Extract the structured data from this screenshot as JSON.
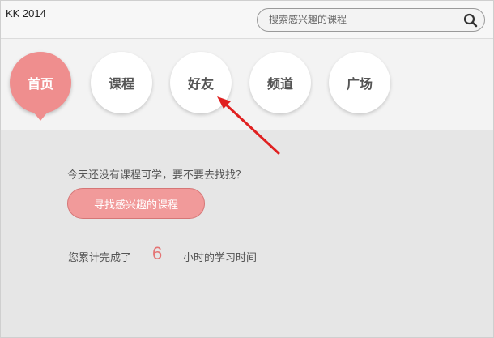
{
  "header": {
    "app_title": "KK 2014",
    "search": {
      "placeholder": "搜索感兴趣的课程",
      "icon": "search-icon"
    }
  },
  "nav": {
    "items": [
      {
        "label": "首页",
        "active": true
      },
      {
        "label": "课程",
        "active": false
      },
      {
        "label": "好友",
        "active": false
      },
      {
        "label": "频道",
        "active": false
      },
      {
        "label": "广场",
        "active": false
      }
    ]
  },
  "main": {
    "prompt": "今天还没有课程可学，要不要去找找？",
    "find_button_label": "寻找感兴趣的课程",
    "stats": {
      "prefix": "您累计完成了",
      "hours": "6",
      "suffix": "小时的学习时间"
    }
  },
  "colors": {
    "accent": "#ef8e8e",
    "button": "#f19a9a",
    "stat_number": "#e47474",
    "annotation_arrow": "#e02020"
  }
}
